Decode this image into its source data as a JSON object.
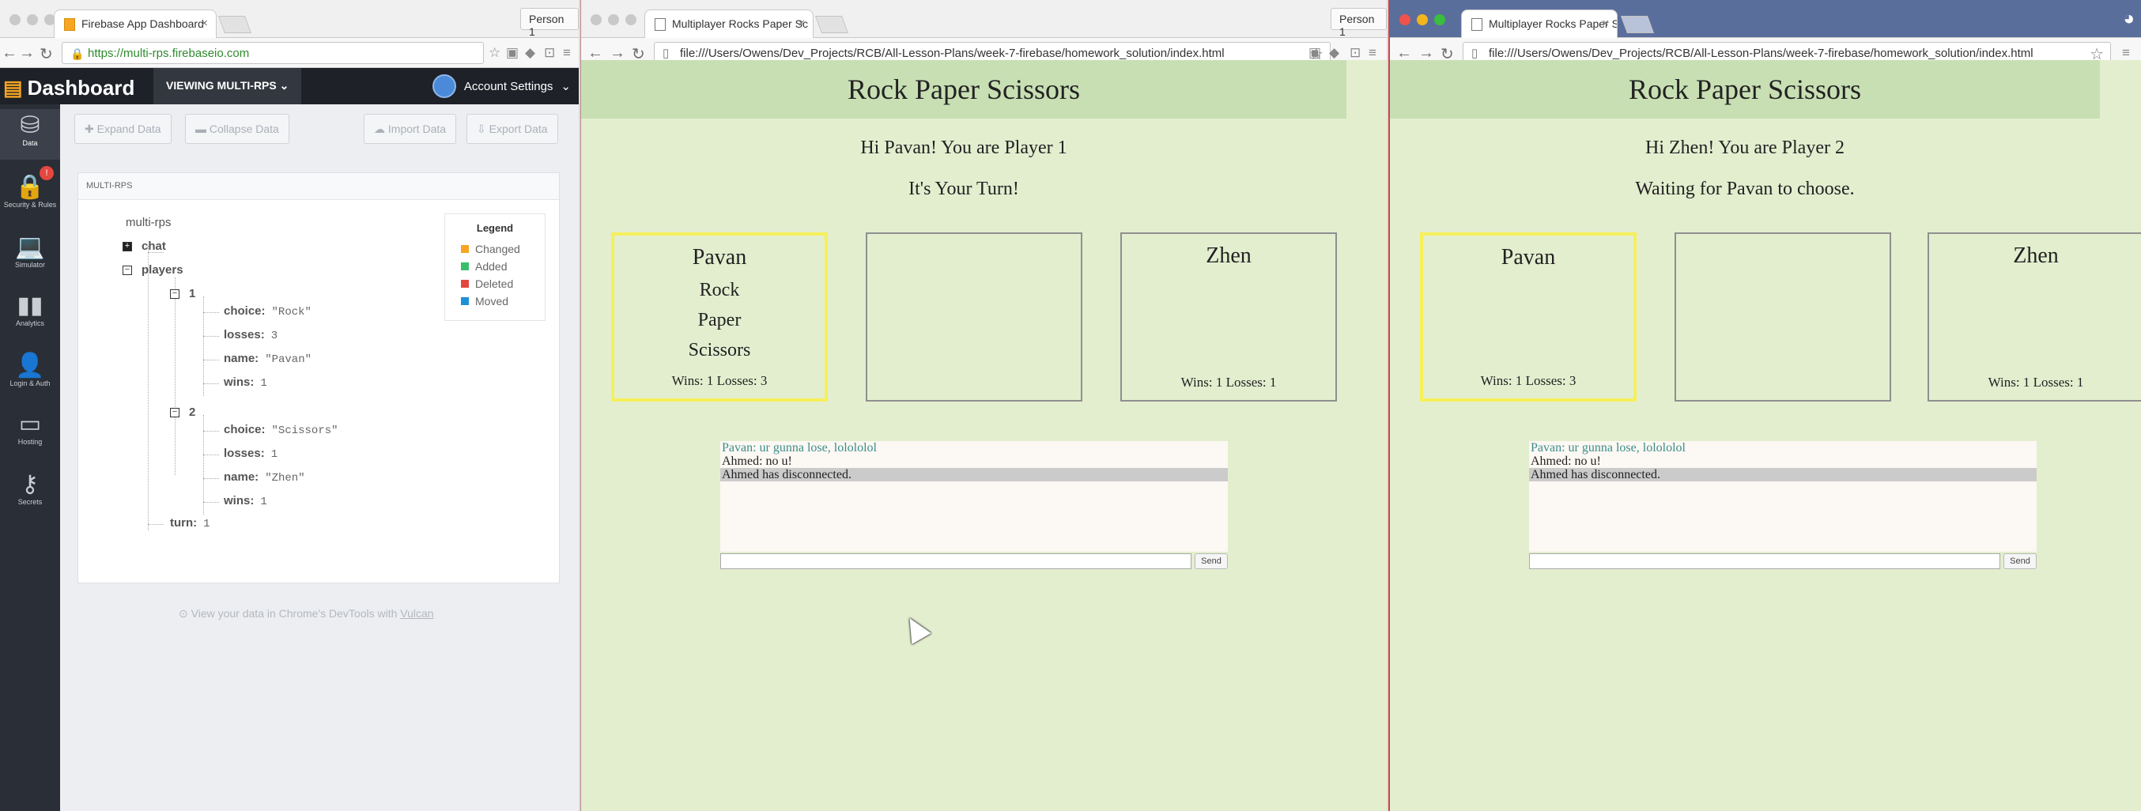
{
  "firebase_window": {
    "tab_title": "Firebase App Dashboard",
    "person": "Person 1",
    "url": "https://multi-rps.firebaseio.com",
    "dashboard_label": "Dashboard",
    "viewing_label": "VIEWING MULTI-RPS",
    "account_label": "Account Settings",
    "sidebar": [
      {
        "label": "Data",
        "icon": "database-icon"
      },
      {
        "label": "Security & Rules",
        "icon": "lock-icon",
        "badge": "!"
      },
      {
        "label": "Simulator",
        "icon": "laptop-icon"
      },
      {
        "label": "Analytics",
        "icon": "bar-chart-icon"
      },
      {
        "label": "Login & Auth",
        "icon": "users-icon"
      },
      {
        "label": "Hosting",
        "icon": "folder-icon"
      },
      {
        "label": "Secrets",
        "icon": "key-icon"
      }
    ],
    "toolbar": {
      "expand": "Expand Data",
      "collapse": "Collapse Data",
      "import": "Import Data",
      "export": "Export Data"
    },
    "breadcrumb": "MULTI-RPS",
    "tree": {
      "root": "multi-rps",
      "chat": "chat",
      "players": "players",
      "p1_key": "1",
      "p1_choice_k": "choice:",
      "p1_choice_v": "\"Rock\"",
      "p1_losses_k": "losses:",
      "p1_losses_v": "3",
      "p1_name_k": "name:",
      "p1_name_v": "\"Pavan\"",
      "p1_wins_k": "wins:",
      "p1_wins_v": "1",
      "p2_key": "2",
      "p2_choice_k": "choice:",
      "p2_choice_v": "\"Scissors\"",
      "p2_losses_k": "losses:",
      "p2_losses_v": "1",
      "p2_name_k": "name:",
      "p2_name_v": "\"Zhen\"",
      "p2_wins_k": "wins:",
      "p2_wins_v": "1",
      "turn_k": "turn:",
      "turn_v": "1"
    },
    "legend": {
      "title": "Legend",
      "items": [
        {
          "label": "Changed",
          "color": "#f6a623"
        },
        {
          "label": "Added",
          "color": "#3bbd6e"
        },
        {
          "label": "Deleted",
          "color": "#e3473f"
        },
        {
          "label": "Moved",
          "color": "#1e90d6"
        }
      ]
    },
    "footer": "View your data in Chrome's DevTools with",
    "footer_link": "Vulcan"
  },
  "game1": {
    "tab_title": "Multiplayer Rocks Paper Sc",
    "person": "Person 1",
    "url": "file:///Users/Owens/Dev_Projects/RCB/All-Lesson-Plans/week-7-firebase/homework_solution/index.html",
    "heading": "Rock Paper Scissors",
    "greeting": "Hi Pavan! You are Player 1",
    "status": "It's Your Turn!",
    "p1_name": "Pavan",
    "choice_rock": "Rock",
    "choice_paper": "Paper",
    "choice_scissors": "Scissors",
    "p1_score": "Wins: 1 Losses: 3",
    "p2_name": "Zhen",
    "p2_score": "Wins: 1 Losses: 1",
    "chat": [
      "Pavan: ur gunna lose, lolololol",
      "Ahmed: no u!",
      "Ahmed has disconnected."
    ],
    "send": "Send"
  },
  "game2": {
    "tab_title": "Multiplayer Rocks Paper Sc",
    "url": "file:///Users/Owens/Dev_Projects/RCB/All-Lesson-Plans/week-7-firebase/homework_solution/index.html",
    "heading": "Rock Paper Scissors",
    "greeting": "Hi Zhen! You are Player 2",
    "status": "Waiting for Pavan to choose.",
    "p1_name": "Pavan",
    "p1_score": "Wins: 1 Losses: 3",
    "p2_name": "Zhen",
    "p2_score": "Wins: 1 Losses: 1",
    "chat": [
      "Pavan: ur gunna lose, lolololol",
      "Ahmed: no u!",
      "Ahmed has disconnected."
    ],
    "send": "Send"
  }
}
